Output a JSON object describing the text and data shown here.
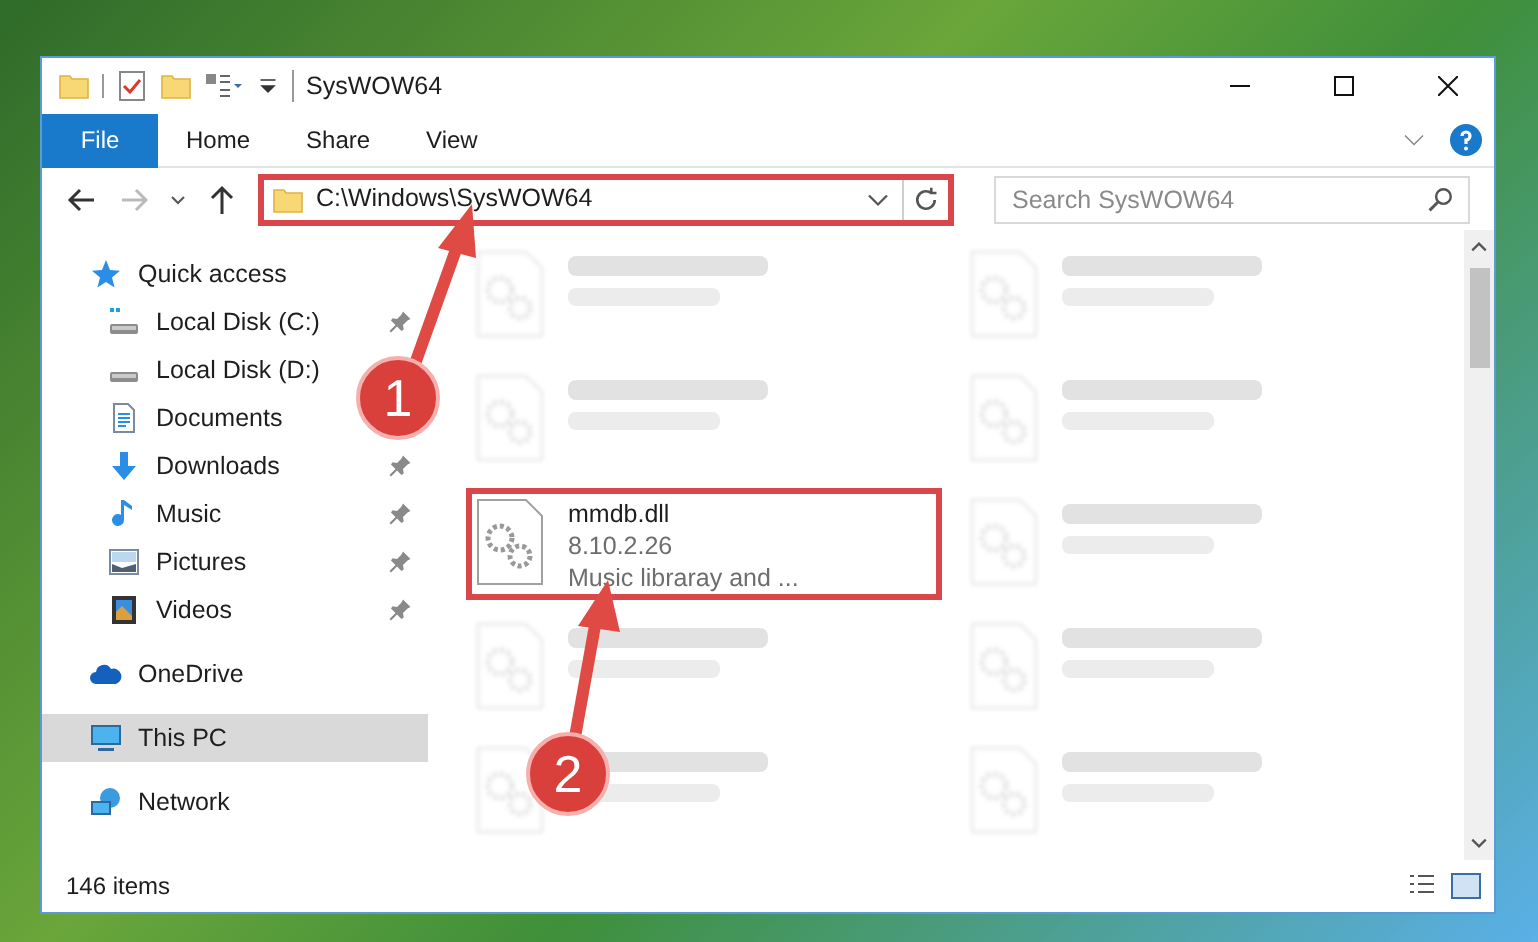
{
  "window": {
    "title": "SysWOW64"
  },
  "ribbon_tabs": [
    {
      "label": "File",
      "selected": true
    },
    {
      "label": "Home",
      "selected": false
    },
    {
      "label": "Share",
      "selected": false
    },
    {
      "label": "View",
      "selected": false
    }
  ],
  "address_bar": {
    "value": "C:\\Windows\\SysWOW64",
    "highlighted": true
  },
  "search": {
    "placeholder": "Search SysWOW64"
  },
  "sidebar": {
    "items": [
      {
        "label": "Quick access",
        "kind": "star",
        "selected": false,
        "children": [
          {
            "label": "Local Disk (C:)",
            "kind": "drive-c",
            "pinned": true,
            "selected": false
          },
          {
            "label": "Local Disk (D:)",
            "kind": "drive",
            "selected": false
          },
          {
            "label": "Documents",
            "kind": "documents",
            "selected": false
          },
          {
            "label": "Downloads",
            "kind": "downloads",
            "pinned": true,
            "selected": false
          },
          {
            "label": "Music",
            "kind": "music",
            "pinned": true,
            "selected": false
          },
          {
            "label": "Pictures",
            "kind": "pictures",
            "pinned": true,
            "selected": false
          },
          {
            "label": "Videos",
            "kind": "videos",
            "pinned": true,
            "selected": false
          }
        ]
      },
      {
        "label": "OneDrive",
        "kind": "cloud",
        "selected": false
      },
      {
        "label": "This PC",
        "kind": "pc",
        "selected": true
      },
      {
        "label": "Network",
        "kind": "network",
        "selected": false
      }
    ]
  },
  "files": [
    {
      "blurred": true,
      "highlighted": false
    },
    {
      "blurred": true,
      "highlighted": false
    },
    {
      "blurred": true,
      "highlighted": false
    },
    {
      "blurred": true,
      "highlighted": false
    },
    {
      "name": "mmdb.dll",
      "details": [
        "8.10.2.26",
        "Music libraray and ..."
      ],
      "blurred": false,
      "highlighted": true
    },
    {
      "blurred": true,
      "highlighted": false
    },
    {
      "blurred": true,
      "highlighted": false
    },
    {
      "blurred": true,
      "highlighted": false
    },
    {
      "blurred": true,
      "highlighted": false
    },
    {
      "blurred": true,
      "highlighted": false
    }
  ],
  "status_bar": {
    "item_count": "146 items"
  },
  "annotations": [
    {
      "label": "1"
    },
    {
      "label": "2"
    }
  ]
}
